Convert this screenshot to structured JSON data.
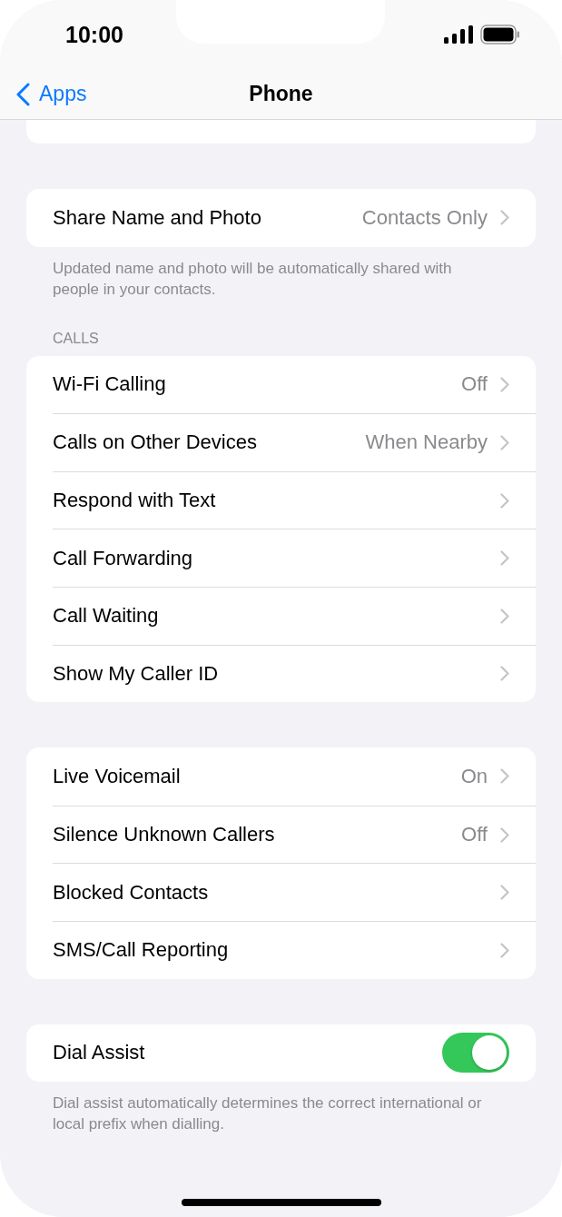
{
  "status_bar": {
    "time": "10:00"
  },
  "nav": {
    "back": "Apps",
    "title": "Phone"
  },
  "groups": [
    {
      "rows": [
        {
          "kind": "link",
          "label": "Share Name and Photo",
          "value": "Contacts Only"
        }
      ],
      "footer": "Updated name and photo will be automatically shared with people in your contacts."
    },
    {
      "header": "CALLS",
      "rows": [
        {
          "kind": "link",
          "label": "Wi-Fi Calling",
          "value": "Off"
        },
        {
          "kind": "link",
          "label": "Calls on Other Devices",
          "value": "When Nearby"
        },
        {
          "kind": "link",
          "label": "Respond with Text"
        },
        {
          "kind": "link",
          "label": "Call Forwarding"
        },
        {
          "kind": "link",
          "label": "Call Waiting"
        },
        {
          "kind": "link",
          "label": "Show My Caller ID"
        }
      ]
    },
    {
      "rows": [
        {
          "kind": "link",
          "label": "Live Voicemail",
          "value": "On"
        },
        {
          "kind": "link",
          "label": "Silence Unknown Callers",
          "value": "Off"
        },
        {
          "kind": "link",
          "label": "Blocked Contacts"
        },
        {
          "kind": "link",
          "label": "SMS/Call Reporting"
        }
      ]
    },
    {
      "rows": [
        {
          "kind": "toggle",
          "label": "Dial Assist",
          "on": true
        }
      ],
      "footer": "Dial assist automatically determines the correct international or local prefix when dialling."
    }
  ]
}
